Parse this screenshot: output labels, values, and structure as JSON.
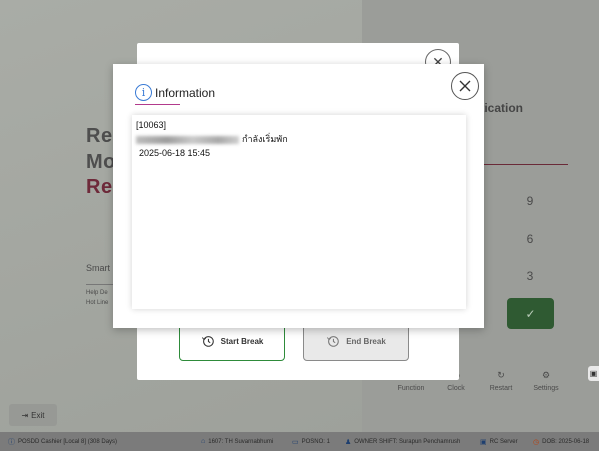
{
  "background": {
    "left_text_lines": [
      "Re",
      "Mo",
      "Re"
    ],
    "smart_text": "Smart",
    "help_lines": [
      "Help De",
      "Hot Line"
    ],
    "auth_title": "ntication",
    "keypad": [
      "9",
      "6",
      "3",
      "✓"
    ],
    "function_buttons": [
      {
        "label": "Function",
        "icon": "function-icon"
      },
      {
        "label": "Clock",
        "icon": "clock-icon"
      },
      {
        "label": "Restart",
        "icon": "restart-icon"
      },
      {
        "label": "Settings",
        "icon": "gear-icon"
      }
    ],
    "exit_label": "Exit"
  },
  "break_dialog": {
    "start_label": "Start Break",
    "end_label": "End Break"
  },
  "info_modal": {
    "title": "Information",
    "lines": {
      "code": "[10063]",
      "status_text": "กำลังเริ่มพัก",
      "datetime": "2025-06-18 15:45"
    }
  },
  "status_bar": {
    "pos_info": "POSDD Cashier [Local 8] (308 Days)",
    "store": "1607: TH Suvarnabhumi",
    "posno": "POSNO: 1",
    "owner_shift": "OWNER SHIFT: Surapun Penchamrush",
    "server": "RC Server",
    "dob": "DOB: 2025-06-18"
  },
  "colors": {
    "accent_blue": "#3a7bd5",
    "accent_magenta": "#b23a8c",
    "start_green": "#2e8b3a"
  }
}
